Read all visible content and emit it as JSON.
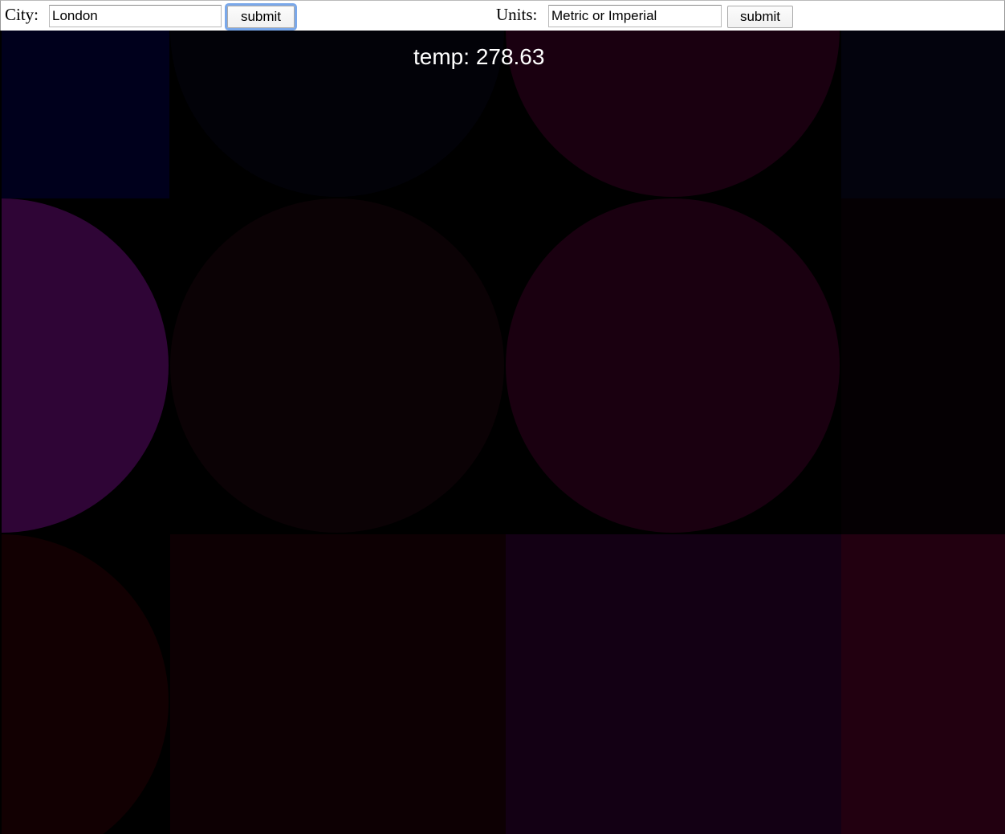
{
  "form": {
    "city_label": "City:",
    "city_value": "London",
    "city_submit": "submit",
    "units_label": "Units:",
    "units_value": "Metric or Imperial",
    "units_submit": "submit"
  },
  "display": {
    "temp_label": "temp:",
    "temp_value": "278.63"
  },
  "colors": {
    "background": "#000000",
    "text": "#ffffff",
    "focus_ring": "#7aa8ea",
    "tile_blue": "#00001c",
    "tile_navy": "#03030d",
    "tile_maroon": "#1a0010",
    "tile_purple": "#2f0536",
    "tile_dark_purple": "#0b0205",
    "tile_dark_red": "#120002",
    "tile_brown_red": "#0d0003",
    "tile_violet": "#130014",
    "tile_crimson": "#220010"
  }
}
